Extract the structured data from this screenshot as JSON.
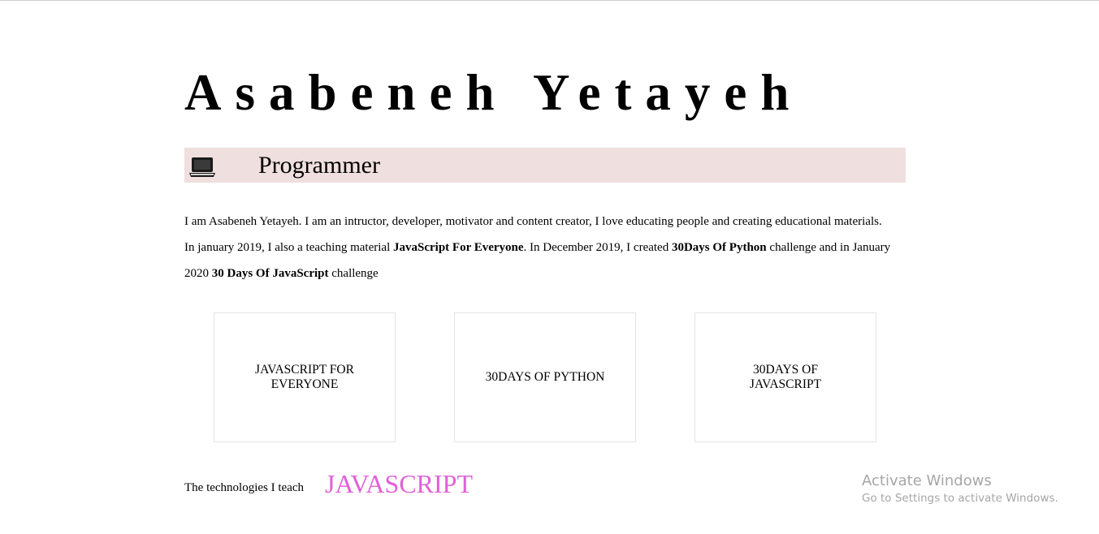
{
  "header": {
    "name": "Asabeneh Yetayeh"
  },
  "role": {
    "icon": "laptop-icon",
    "label": "Programmer",
    "bar_color": "#efdfde"
  },
  "bio": {
    "segments": [
      {
        "text": "I am Asabeneh Yetayeh. I am an intructor, developer, motivator and content creator, I love educating people and creating educational materials. In january 2019, I also a teaching material ",
        "bold": false
      },
      {
        "text": "JavaScript For Everyone",
        "bold": true
      },
      {
        "text": ". In December 2019, I created ",
        "bold": false
      },
      {
        "text": "30Days Of Python",
        "bold": true
      },
      {
        "text": " challenge and in January 2020 ",
        "bold": false
      },
      {
        "text": "30 Days Of JavaScript",
        "bold": true
      },
      {
        "text": " challenge",
        "bold": false
      }
    ]
  },
  "cards": [
    {
      "lines": [
        "JAVASCRIPT FOR",
        "EVERYONE"
      ]
    },
    {
      "lines": [
        "30DAYS OF PYTHON"
      ]
    },
    {
      "lines": [
        "30DAYS OF",
        "JAVASCRIPT"
      ]
    }
  ],
  "technologies": {
    "label": "The technologies I teach",
    "current": "JAVASCRIPT",
    "current_color": "#e060d8"
  },
  "watermark": {
    "title": "Activate Windows",
    "subtitle": "Go to Settings to activate Windows."
  }
}
